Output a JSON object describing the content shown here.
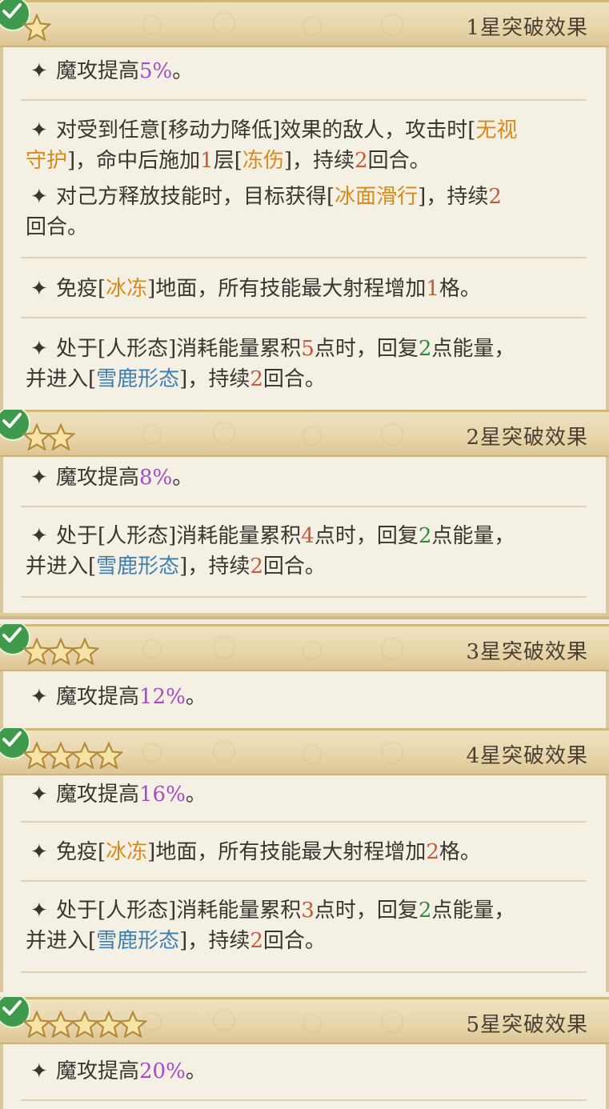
{
  "sections": [
    {
      "title": "1星突破效果",
      "stars": 1,
      "effects": [
        [
          "魔攻提高",
          "5%",
          "。"
        ],
        [
          "对受到任意[移动力降低]效果的敌人，攻击时[",
          "无视",
          "守护",
          "]，命中后施加",
          "1",
          "层[",
          "冻伤",
          "]，持续",
          "2",
          "回合。"
        ],
        [
          "对己方释放技能时，目标获得[",
          "冰面滑行",
          "]，持续",
          "2",
          "回合。"
        ],
        [
          "免疫[",
          "冰冻",
          "]地面，所有技能最大射程增加",
          "1",
          "格。"
        ],
        [
          "处于[人形态]消耗能量累积",
          "5",
          "点时，回复",
          "2",
          "点能量，",
          "并进入[",
          "雪鹿形态",
          "]，持续",
          "2",
          "回合。"
        ]
      ]
    },
    {
      "title": "2星突破效果",
      "stars": 2,
      "effects": [
        [
          "魔攻提高",
          "8%",
          "。"
        ],
        [
          "处于[人形态]消耗能量累积",
          "4",
          "点时，回复",
          "2",
          "点能量，",
          "并进入[",
          "雪鹿形态",
          "]，持续",
          "2",
          "回合。"
        ]
      ]
    },
    {
      "title": "3星突破效果",
      "stars": 3,
      "effects": [
        [
          "魔攻提高",
          "12%",
          "。"
        ]
      ]
    },
    {
      "title": "4星突破效果",
      "stars": 4,
      "effects": [
        [
          "魔攻提高",
          "16%",
          "。"
        ],
        [
          "免疫[",
          "冰冻",
          "]地面，所有技能最大射程增加",
          "2",
          "格。"
        ],
        [
          "处于[人形态]消耗能量累积",
          "3",
          "点时，回复",
          "2",
          "点能量，",
          "并进入[",
          "雪鹿形态",
          "]，持续",
          "2",
          "回合。"
        ]
      ]
    },
    {
      "title": "5星突破效果",
      "stars": 5,
      "effects": [
        [
          "魔攻提高",
          "20%",
          "。"
        ]
      ]
    }
  ],
  "icons": {
    "check": "check-icon",
    "star": "star-icon",
    "bullet": "sparkle-icon"
  },
  "colors": {
    "purple": "#a54cc6",
    "orange": "#d78a1a",
    "red": "#c65b3a",
    "green": "#2d8b3a",
    "blue": "#3f7fb0",
    "check": "#3f9a4c"
  }
}
